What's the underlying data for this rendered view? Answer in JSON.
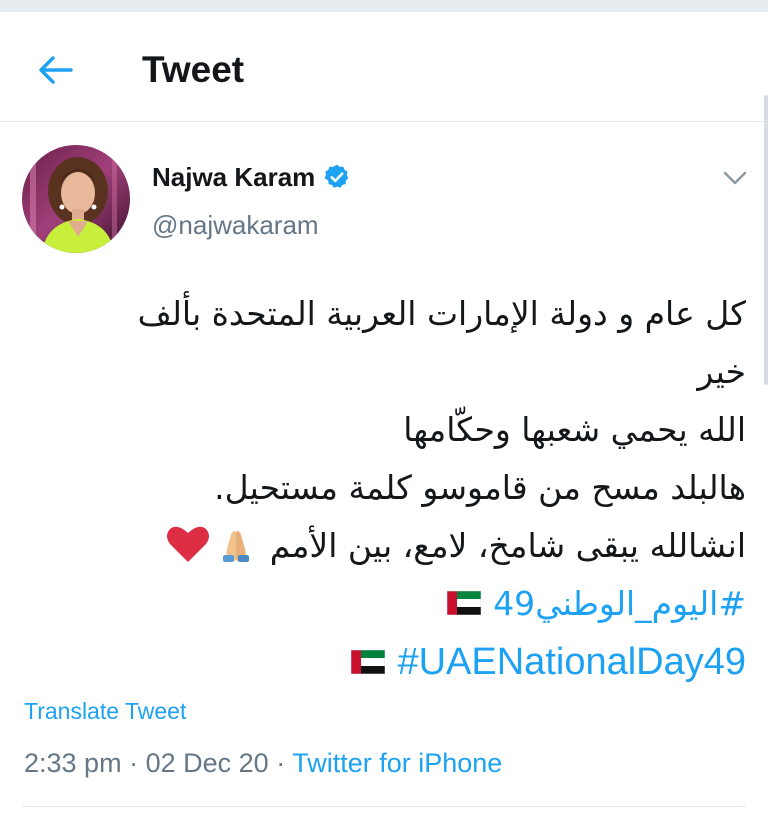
{
  "header": {
    "title": "Tweet",
    "back_icon": "arrow-left-icon"
  },
  "author": {
    "name": "Najwa Karam",
    "handle": "@najwakaram",
    "verified": true,
    "verified_icon": "verified-badge-icon",
    "menu_icon": "chevron-down-icon"
  },
  "tweet": {
    "lines": [
      "كل عام و دولة الإمارات العربية المتحدة بألف",
      "خير",
      "الله يحمي شعبها وحكّامها",
      "هالبلد مسح من قاموسو كلمة مستحيل.",
      "انشالله يبقى شامخ، لامع، بين الأمم"
    ],
    "line5_emojis": [
      "folded-hands-emoji",
      "red-heart-emoji"
    ],
    "hashtag_arabic": "#اليوم_الوطني49",
    "hashtag_latin": "#UAENationalDay49",
    "flag_emoji": "uae-flag-emoji"
  },
  "translate_label": "Translate Tweet",
  "meta": {
    "time": "2:33 pm",
    "separator": "·",
    "date": "02 Dec 20",
    "source": "Twitter for iPhone"
  },
  "colors": {
    "link": "#1da1f2",
    "secondary_text": "#657786",
    "primary_text": "#14171a",
    "border": "#e6ecf0"
  }
}
